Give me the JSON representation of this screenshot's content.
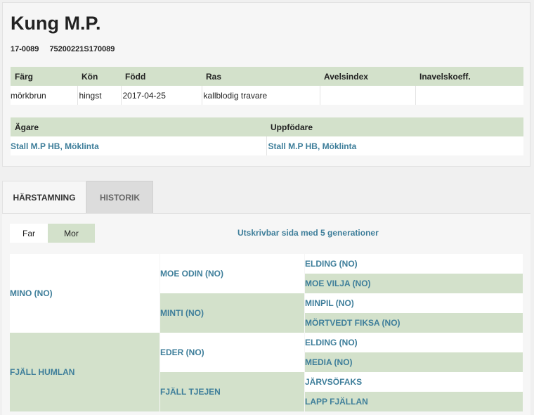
{
  "horse": {
    "name": "Kung M.P.",
    "reg_no": "17-0089",
    "ueln": "75200221S170089"
  },
  "details_table": {
    "headers": [
      "Färg",
      "Kön",
      "Född",
      "Ras",
      "Avelsindex",
      "Inavelskoeff."
    ],
    "values": [
      "mörkbrun",
      "hingst",
      "2017-04-25",
      "kallblodig travare",
      "",
      ""
    ]
  },
  "owner_table": {
    "headers": [
      "Ägare",
      "Uppfödare"
    ],
    "values": [
      "Stall M.P HB, Möklinta",
      "Stall M.P HB, Möklinta"
    ]
  },
  "tabs": [
    "HÄRSTAMNING",
    "HISTORIK"
  ],
  "toggle": {
    "far": "Far",
    "mor": "Mor"
  },
  "print_link": "Utskrivbar sida med 5 generationer",
  "pedigree": {
    "gen1": [
      "MINO (NO)",
      "FJÄLL HUMLAN"
    ],
    "gen2": [
      "MOE ODIN (NO)",
      "MINTI (NO)",
      "EDER (NO)",
      "FJÄLL TJEJEN"
    ],
    "gen3": [
      "ELDING (NO)",
      "MOE VILJA (NO)",
      "MINPIL (NO)",
      "MÖRTVEDT FIKSA (NO)",
      "ELDING (NO)",
      "MEDIA (NO)",
      "JÄRVSÖFAKS",
      "LAPP FJÄLLAN"
    ]
  },
  "colors": {
    "header_green": "#d3e1cb",
    "link_blue": "#3e7e9a"
  }
}
